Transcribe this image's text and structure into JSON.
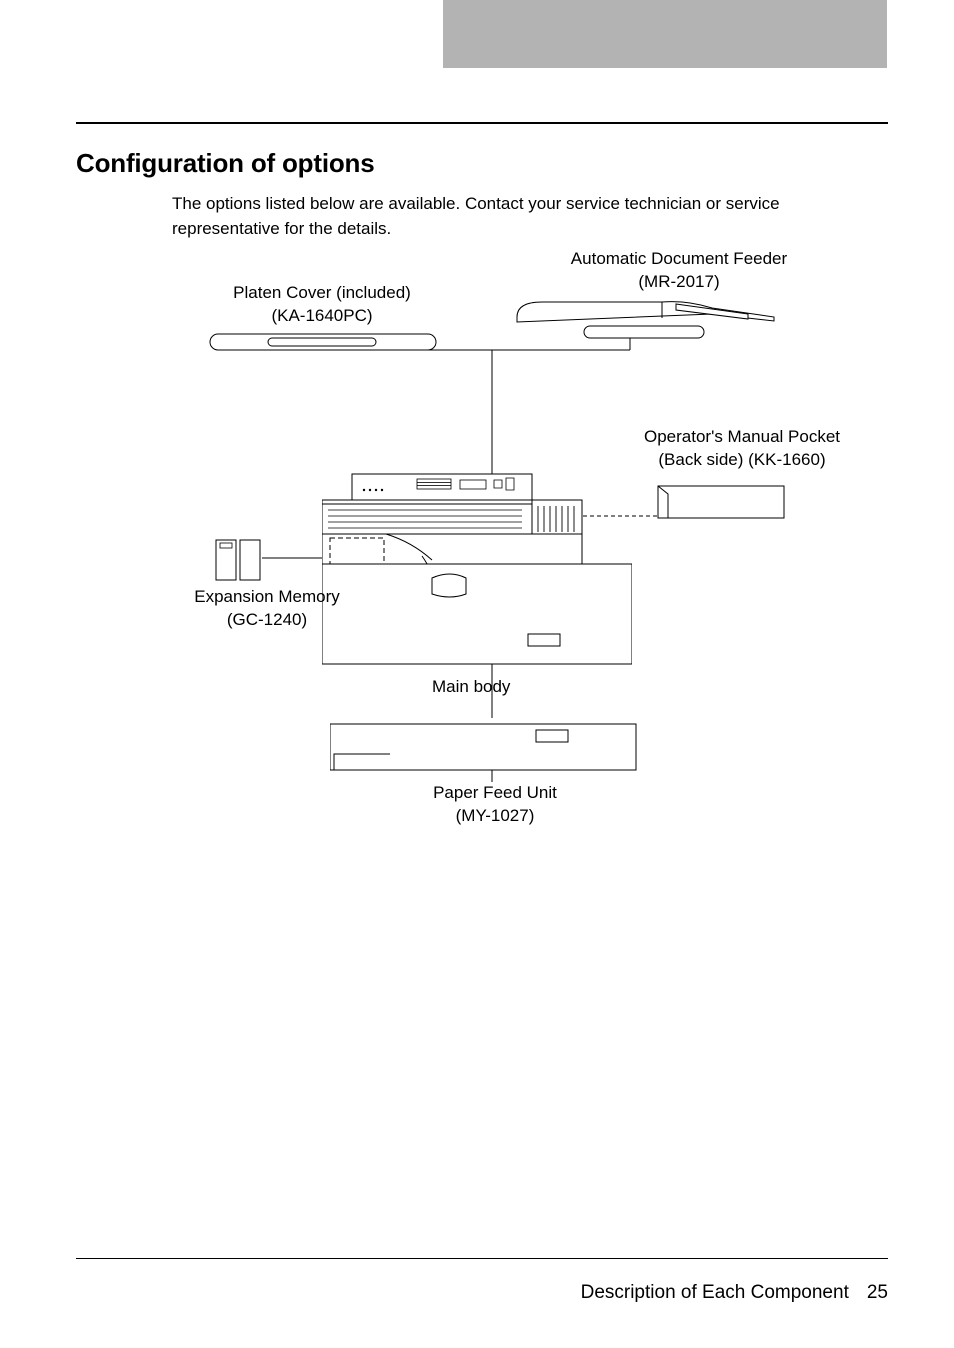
{
  "header": {
    "section_title": "Configuration of options",
    "intro_text": "The options listed below are available. Contact your service technician or service representative for the details."
  },
  "labels": {
    "adf_name": "Automatic Document Feeder",
    "adf_model": "(MR-2017)",
    "platen_name": "Platen Cover (included)",
    "platen_model": "(KA-1640PC)",
    "pocket_name": "Operator's Manual Pocket",
    "pocket_sub": "(Back side) (KK-1660)",
    "expmem_name": "Expansion Memory",
    "expmem_model": "(GC-1240)",
    "mainbody": "Main body",
    "pfu_name": "Paper Feed Unit",
    "pfu_model": "(MY-1027)"
  },
  "footer": {
    "chapter": "Description of Each Component",
    "page_num": "25"
  }
}
